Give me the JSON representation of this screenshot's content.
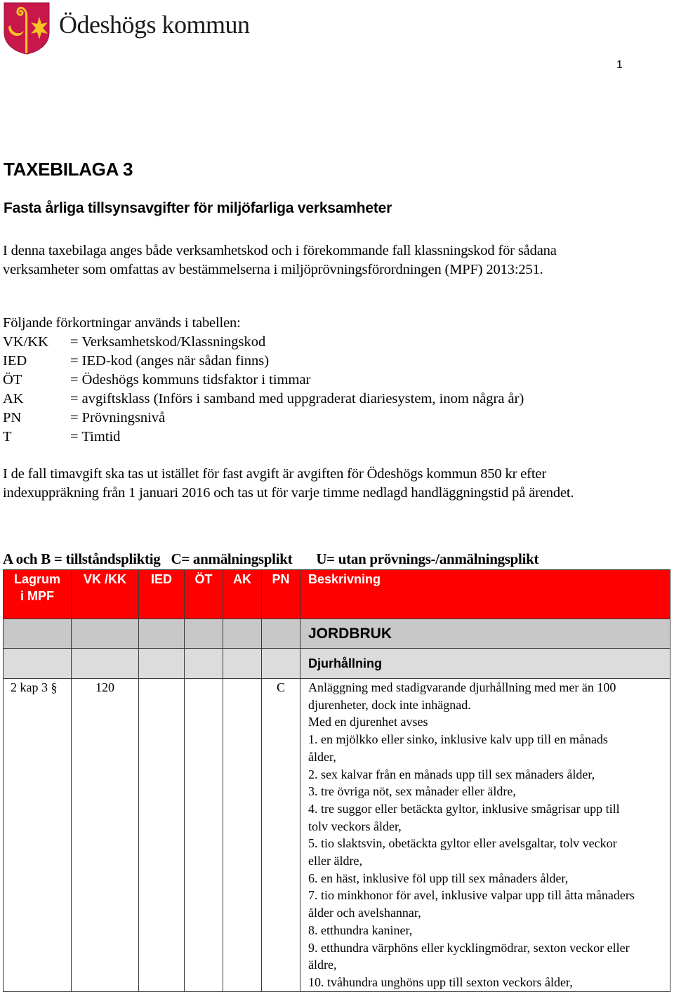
{
  "header": {
    "logo_text": "Ödeshögs kommun",
    "page_number": "1"
  },
  "document": {
    "title": "TAXEBILAGA 3",
    "subtitle": "Fasta årliga tillsynsavgifter för miljöfarliga verksamheter",
    "intro": "I denna taxebilaga anges både verksamhetskod och i förekommande fall klassningskod för sådana verksamheter som omfattas av bestämmelserna i miljöprövningsförordningen (MPF) 2013:251.",
    "abbreviations_intro": "Följande förkortningar används i tabellen:",
    "abbreviations": [
      {
        "key": "VK/KK",
        "value": "= Verksamhetskod/Klassningskod"
      },
      {
        "key": "IED",
        "value": "= IED-kod (anges när sådan finns)"
      },
      {
        "key": "ÖT",
        "value": "= Ödeshögs kommuns tidsfaktor i timmar"
      },
      {
        "key": "AK",
        "value": "= avgiftsklass (Införs i samband med uppgraderat diariesystem, inom några år)"
      },
      {
        "key": "PN",
        "value": "= Prövningsnivå"
      },
      {
        "key": "T",
        "value": "= Timtid"
      }
    ],
    "hourly_fee_text": "I de fall timavgift ska tas ut istället för fast avgift är avgiften för Ödeshögs kommun 850 kr efter indexuppräkning från 1 januari 2016 och tas ut för varje timme nedlagd handläggningstid på ärendet.",
    "legend": [
      "A och B = tillståndspliktig",
      "C= anmälningsplikt",
      "U= utan prövnings-/anmälningsplikt"
    ]
  },
  "table": {
    "columns": [
      "Lagrum i MPF",
      "VK /KK",
      "IED",
      "ÖT",
      "AK",
      "PN",
      "Beskrivning"
    ],
    "column_lines": [
      [
        "Lagrum",
        "i MPF"
      ],
      [
        "VK /KK"
      ],
      [
        "IED"
      ],
      [
        "ÖT"
      ],
      [
        "AK"
      ],
      [
        "PN"
      ],
      [
        "Beskrivning"
      ]
    ],
    "category": "JORDBRUK",
    "subcategory": "Djurhållning",
    "rows": [
      {
        "lagrum": "2 kap 3 §",
        "vk_kk": "120",
        "ied": "",
        "ot": "",
        "ak": "",
        "pn": "C",
        "description_lines": [
          "Anläggning med stadigvarande djurhållning med mer än 100",
          "djurenheter, dock inte inhägnad.",
          "Med en djurenhet avses",
          "1. en mjölkko eller sinko, inklusive kalv upp till en månads",
          "ålder,",
          "2. sex kalvar från en månads upp till sex månaders ålder,",
          "3. tre övriga nöt, sex månader eller äldre,",
          "4. tre suggor eller betäckta gyltor, inklusive smågrisar upp till",
          "tolv veckors ålder,",
          "5. tio slaktsvin, obetäckta gyltor eller avelsgaltar, tolv veckor",
          "eller äldre,",
          "6. en häst, inklusive föl upp till sex månaders ålder,",
          "7. tio minkhonor för avel, inklusive valpar upp till åtta månaders",
          "ålder och avelshannar,",
          "8. etthundra kaniner,",
          "9. etthundra värphöns eller kycklingmödrar, sexton veckor eller",
          "äldre,",
          "10. tvåhundra unghöns upp till sexton veckors ålder,"
        ]
      }
    ]
  },
  "colors": {
    "header_red": "#ff0000",
    "category_gray": "#c8c8c8",
    "subcategory_gray": "#dcdcdc",
    "shield_red": "#c8174a",
    "emblem_yellow": "#f7c325"
  }
}
